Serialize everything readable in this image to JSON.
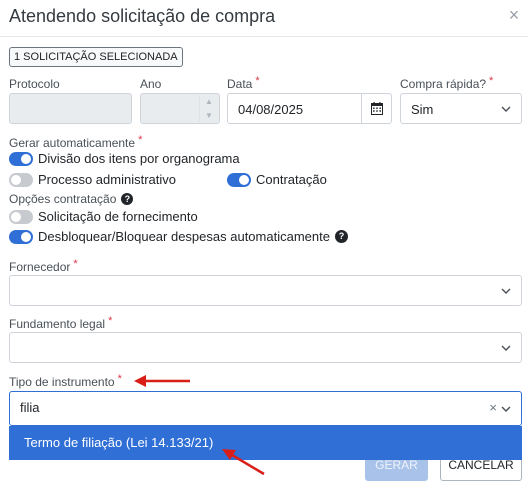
{
  "dialog": {
    "title": "Atendendo solicitação de compra",
    "close_glyph": "×",
    "selection_badge": "1 SOLICITAÇÃO SELECIONADA"
  },
  "fields": {
    "protocolo": {
      "label": "Protocolo",
      "value": ""
    },
    "ano": {
      "label": "Ano",
      "value": ""
    },
    "data": {
      "label": "Data",
      "required": "*",
      "value": "04/08/2025"
    },
    "compra_rapida": {
      "label": "Compra rápida?",
      "required": "*",
      "value": "Sim"
    },
    "fornecedor": {
      "label": "Fornecedor",
      "required": "*",
      "value": ""
    },
    "fundamento_legal": {
      "label": "Fundamento legal",
      "required": "*",
      "value": ""
    },
    "tipo_instrumento": {
      "label": "Tipo de instrumento",
      "required": "*",
      "search_value": "filia",
      "clear_glyph": "×"
    }
  },
  "gerar_automaticamente": {
    "label": "Gerar automaticamente",
    "required": "*",
    "toggles": [
      {
        "label": "Divisão dos itens por organograma",
        "on": true
      },
      {
        "label": "Processo administrativo",
        "on": false
      },
      {
        "label": "Contratação",
        "on": true
      }
    ]
  },
  "opcoes_contratacao": {
    "label": "Opções contratação",
    "help_glyph": "?",
    "toggles": [
      {
        "label": "Solicitação de fornecimento",
        "on": false
      },
      {
        "label": "Desbloquear/Bloquear despesas automaticamente",
        "on": true
      }
    ]
  },
  "dropdown_options": [
    {
      "label": "Termo de filiação (Lei 14.133/21)",
      "highlighted": true
    }
  ],
  "buttons": {
    "gerar": "GERAR",
    "cancelar": "CANCELAR"
  },
  "colors": {
    "primary": "#2f6fd6",
    "required": "#dc3545",
    "annotation_arrow": "#d91e18"
  },
  "icons": {
    "close": "close-icon",
    "calendar": "calendar-icon",
    "chevron": "chevron-down-icon",
    "help": "help-icon"
  }
}
